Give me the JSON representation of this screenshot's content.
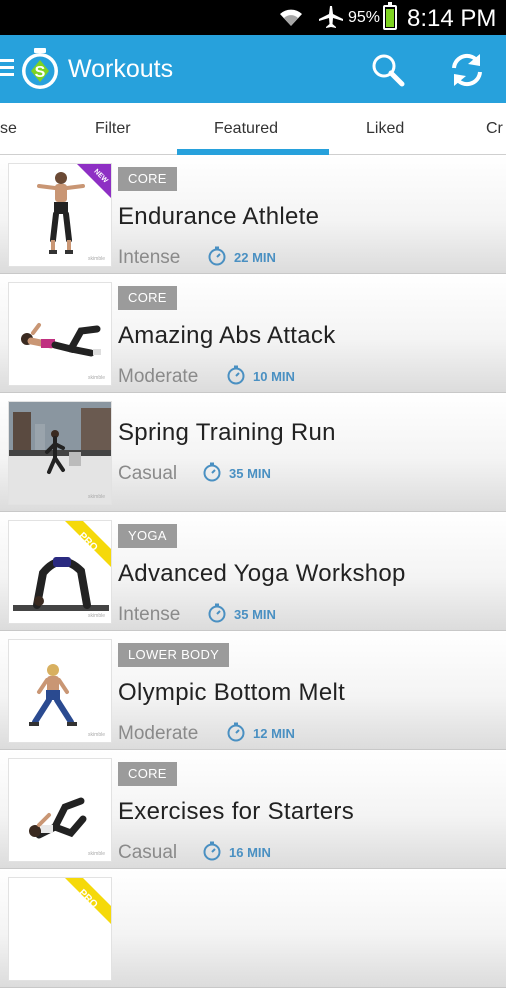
{
  "status_bar": {
    "battery_percent": "95%",
    "battery_level": 0.95,
    "time": "8:14 PM"
  },
  "action_bar": {
    "title": "Workouts"
  },
  "tabs": [
    {
      "label": "se"
    },
    {
      "label": "Filter"
    },
    {
      "label": "Featured",
      "selected": true
    },
    {
      "label": "Liked"
    },
    {
      "label": "Cr"
    }
  ],
  "workouts": [
    {
      "tag": "CORE",
      "title": "Endurance Athlete",
      "level": "Intense",
      "duration": "22 MIN",
      "badge": "NEW"
    },
    {
      "tag": "CORE",
      "title": "Amazing Abs Attack",
      "level": "Moderate",
      "duration": "10 MIN"
    },
    {
      "tag": "",
      "title": "Spring Training Run",
      "level": "Casual",
      "duration": "35 MIN"
    },
    {
      "tag": "YOGA",
      "title": "Advanced Yoga Workshop",
      "level": "Intense",
      "duration": "35 MIN",
      "badge": "PRO"
    },
    {
      "tag": "LOWER BODY",
      "title": "Olympic Bottom Melt",
      "level": "Moderate",
      "duration": "12 MIN"
    },
    {
      "tag": "CORE",
      "title": "Exercises for Starters",
      "level": "Casual",
      "duration": "16 MIN"
    },
    {
      "tag": "",
      "title": "",
      "level": "",
      "duration": "",
      "badge": "PRO"
    }
  ],
  "colors": {
    "accent": "#27a1dc",
    "tag_bg": "#9b9b9b",
    "duration": "#4a90c2",
    "pro": "#f5d90a",
    "new": "#8e2fc4"
  }
}
